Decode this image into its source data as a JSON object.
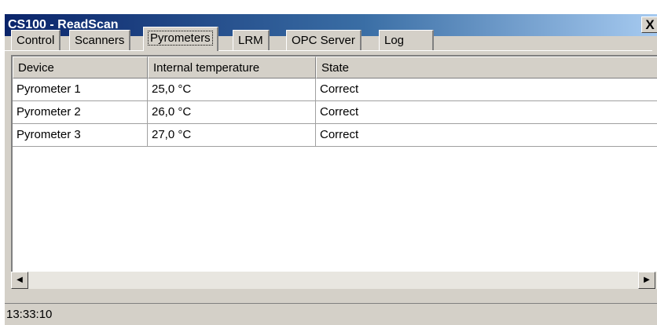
{
  "window": {
    "title": "CS100 - ReadScan",
    "close_glyph": "X"
  },
  "tabs": [
    {
      "label": "Control",
      "active": false
    },
    {
      "label": "Scanners",
      "active": false
    },
    {
      "label": "Pyrometers",
      "active": true
    },
    {
      "label": "LRM",
      "active": false
    },
    {
      "label": "OPC Server",
      "active": false
    },
    {
      "label": "Log",
      "active": false
    }
  ],
  "table": {
    "columns": [
      "Device",
      "Internal temperature",
      "State"
    ],
    "rows": [
      [
        "Pyrometer 1",
        "25,0 °C",
        "Correct"
      ],
      [
        "Pyrometer 2",
        "26,0 °C",
        "Correct"
      ],
      [
        "Pyrometer 3",
        "27,0 °C",
        "Correct"
      ]
    ]
  },
  "scrollbar": {
    "left_icon": "arrow-left-icon",
    "right_icon": "arrow-right-icon"
  },
  "status": {
    "time": "13:33:10"
  },
  "colors": {
    "title_gradient_start": "#0a246a",
    "title_gradient_end": "#a6caf0",
    "face": "#d4d0c8"
  }
}
